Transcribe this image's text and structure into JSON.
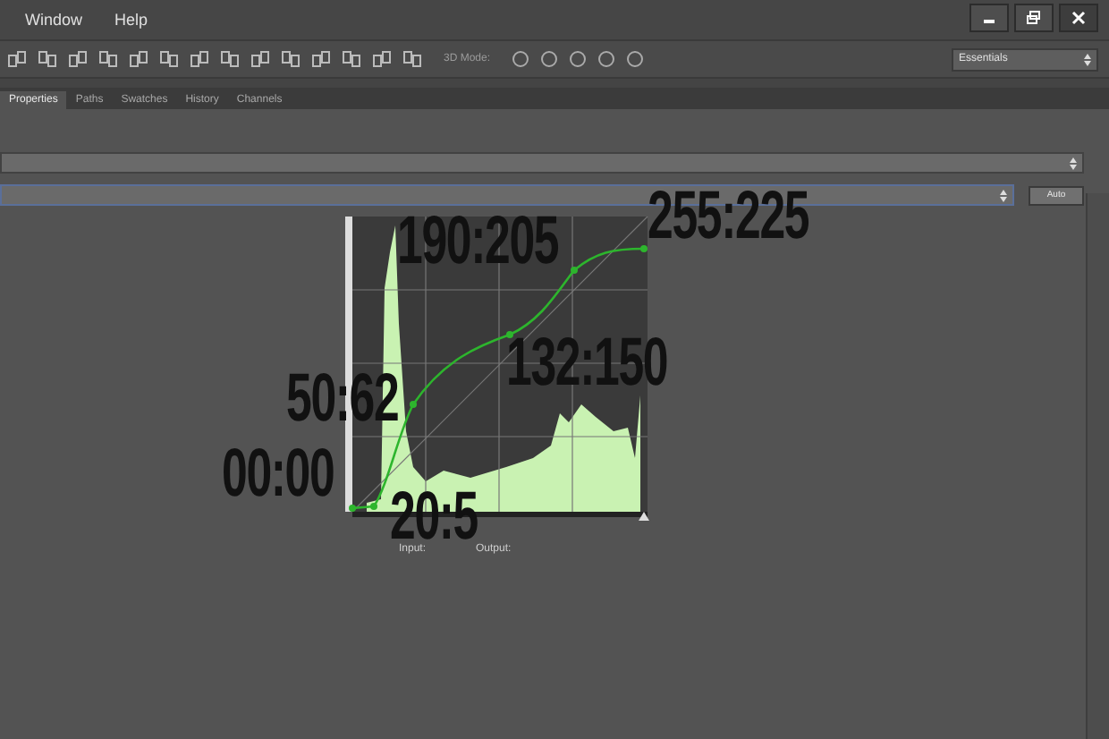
{
  "menu_bar": {
    "items": [
      "Window",
      "Help"
    ]
  },
  "options_bar": {
    "mode_label": "3D Mode:",
    "workspace": "Essentials"
  },
  "panel_tabs": [
    {
      "label": "Properties",
      "selected": true
    },
    {
      "label": "Paths",
      "selected": false
    },
    {
      "label": "Swatches",
      "selected": false
    },
    {
      "label": "History",
      "selected": false
    },
    {
      "label": "Channels",
      "selected": false
    }
  ],
  "properties": {
    "auto_button": "Auto",
    "input_label": "Input:",
    "output_label": "Output:"
  },
  "annotations": [
    {
      "text": "255:225"
    },
    {
      "text": "190:205"
    },
    {
      "text": "132:150"
    },
    {
      "text": "50:62"
    },
    {
      "text": "00:00"
    },
    {
      "text": "20:5"
    }
  ]
}
